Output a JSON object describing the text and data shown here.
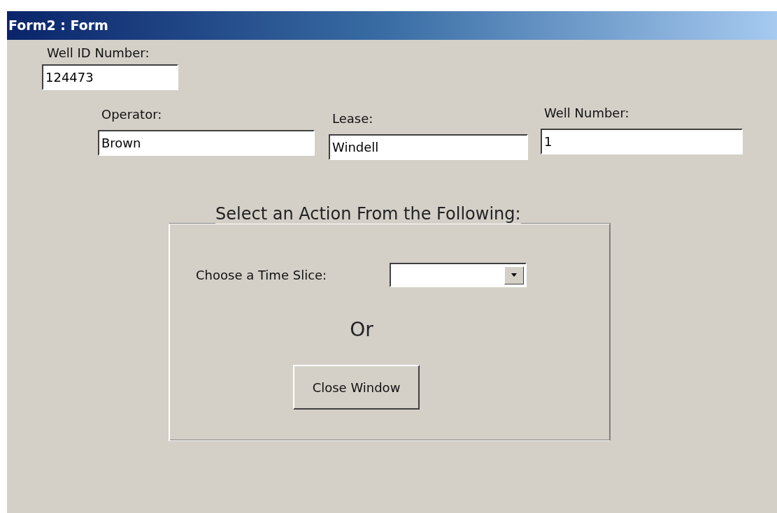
{
  "window": {
    "title": "Form2 : Form"
  },
  "well_id": {
    "label": "Well ID Number:",
    "value": "124473"
  },
  "fields": [
    {
      "label": "Operator:",
      "value": "Brown"
    },
    {
      "label": "Lease:",
      "value": "Windell"
    },
    {
      "label": "Well Number:",
      "value": "1"
    }
  ],
  "action_group": {
    "title": "Select an Action From the Following:",
    "time_slice_label": "Choose a Time Slice:",
    "or_text": "Or",
    "close_button": "Close Window"
  }
}
